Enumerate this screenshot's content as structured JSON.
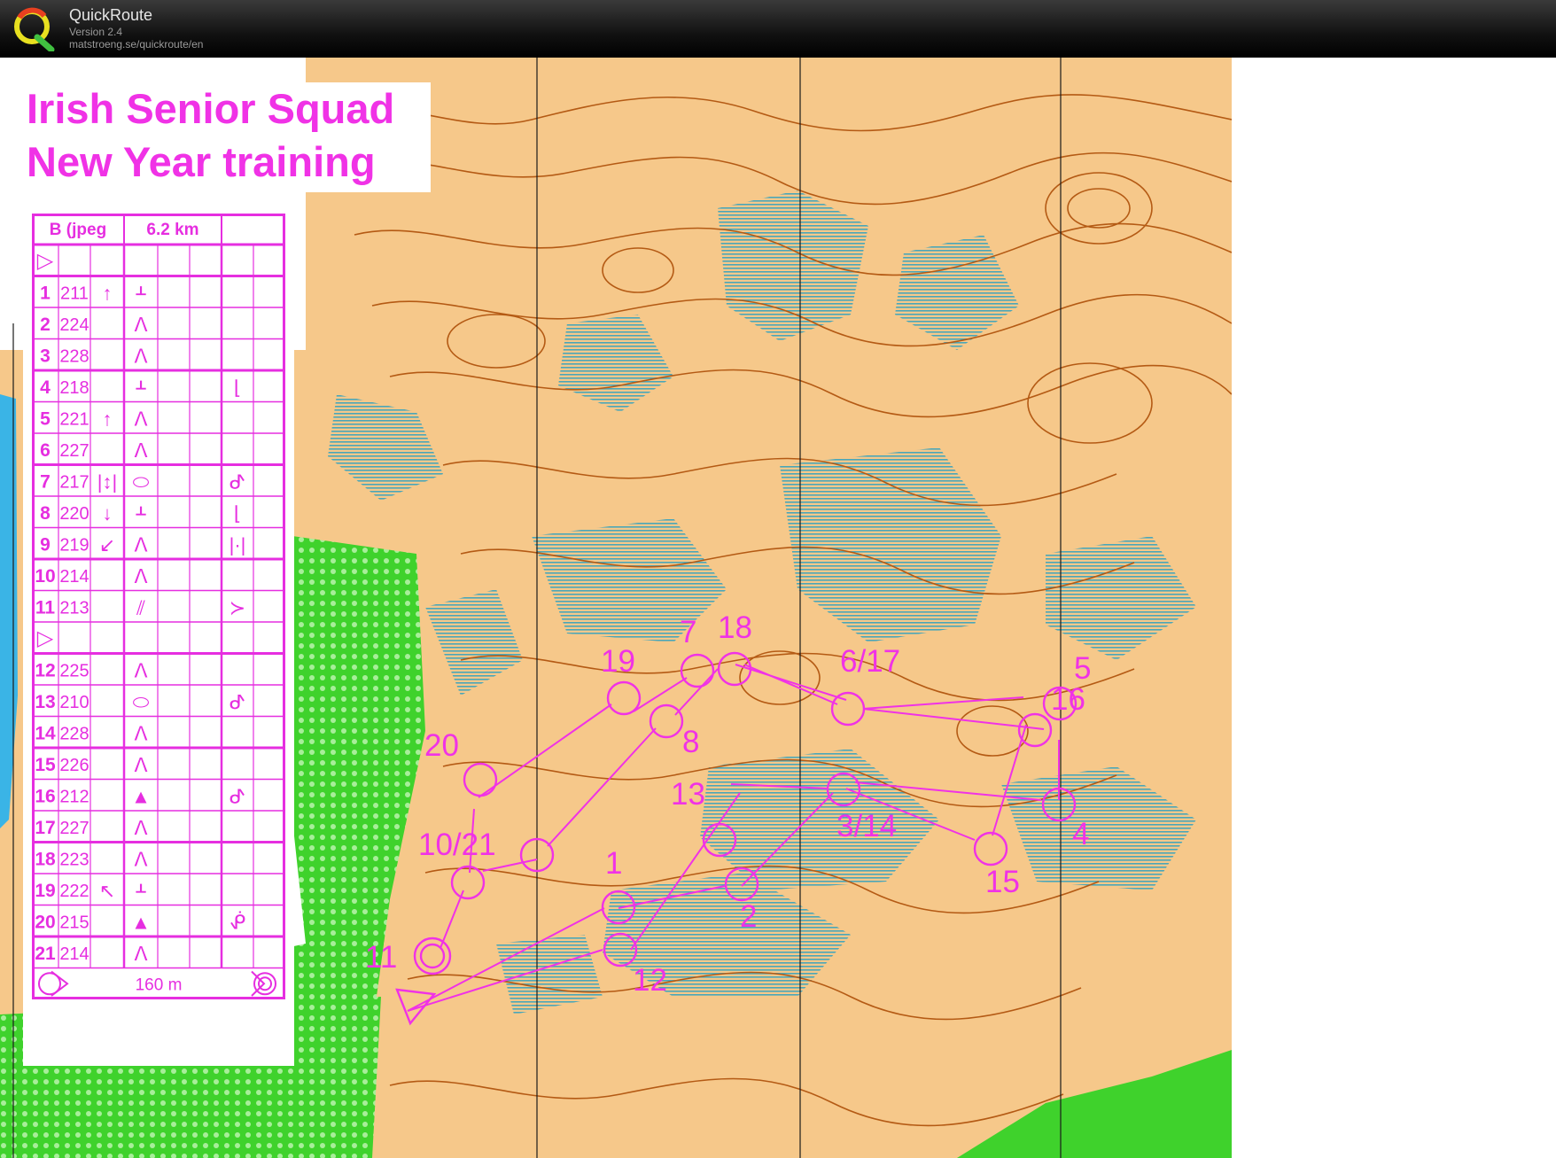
{
  "app": {
    "name": "QuickRoute",
    "version": "Version 2.4",
    "url": "matstroeng.se/quickroute/en"
  },
  "map": {
    "title_line1": "Irish Senior Squad",
    "title_line2": "New Year training",
    "colors": {
      "open_land": "#f6c88a",
      "contour": "#b45a14",
      "marsh": "#4aa6b8",
      "forest": "#3fd22c",
      "course": "#f032e6",
      "water": "#3ab4e6"
    },
    "control_labels": [
      "7",
      "18",
      "19",
      "6/17",
      "5",
      "16",
      "8",
      "20",
      "13",
      "3/14",
      "4",
      "10/21",
      "1",
      "15",
      "2",
      "11",
      "12"
    ]
  },
  "control_card": {
    "course": "B (jpeg",
    "length": "6.2 km",
    "start_symbol": "▷",
    "rows": [
      {
        "num": "1",
        "code": "211",
        "dir": "↑",
        "feat": "ᚆ",
        "extra": ""
      },
      {
        "num": "2",
        "code": "224",
        "dir": "",
        "feat": "ᐱ",
        "extra": ""
      },
      {
        "num": "3",
        "code": "228",
        "dir": "",
        "feat": "ᐱ",
        "extra": ""
      },
      {
        "num": "4",
        "code": "218",
        "dir": "",
        "feat": "ᚆ",
        "extra": "⌊"
      },
      {
        "num": "5",
        "code": "221",
        "dir": "↑",
        "feat": "ᐱ",
        "extra": ""
      },
      {
        "num": "6",
        "code": "227",
        "dir": "",
        "feat": "ᐱ",
        "extra": ""
      },
      {
        "num": "7",
        "code": "217",
        "dir": "|↕|",
        "feat": "⬭",
        "extra": "ᕷ"
      },
      {
        "num": "8",
        "code": "220",
        "dir": "↓",
        "feat": "ᚆ",
        "extra": "⌊"
      },
      {
        "num": "9",
        "code": "219",
        "dir": "↙",
        "feat": "ᐱ",
        "extra": "|·|"
      },
      {
        "num": "10",
        "code": "214",
        "dir": "",
        "feat": "ᐱ",
        "extra": ""
      },
      {
        "num": "11",
        "code": "213",
        "dir": "",
        "feat": "⫽",
        "extra": "≻"
      },
      {
        "num": "",
        "code": "",
        "dir": "",
        "feat": "",
        "extra": "",
        "symbol": "▷"
      },
      {
        "num": "12",
        "code": "225",
        "dir": "",
        "feat": "ᐱ",
        "extra": ""
      },
      {
        "num": "13",
        "code": "210",
        "dir": "",
        "feat": "⬭",
        "extra": "ᕷ"
      },
      {
        "num": "14",
        "code": "228",
        "dir": "",
        "feat": "ᐱ",
        "extra": ""
      },
      {
        "num": "15",
        "code": "226",
        "dir": "",
        "feat": "ᐱ",
        "extra": ""
      },
      {
        "num": "16",
        "code": "212",
        "dir": "",
        "feat": "▲",
        "extra": "ᕷ"
      },
      {
        "num": "17",
        "code": "227",
        "dir": "",
        "feat": "ᐱ",
        "extra": ""
      },
      {
        "num": "18",
        "code": "223",
        "dir": "",
        "feat": "ᐱ",
        "extra": ""
      },
      {
        "num": "19",
        "code": "222",
        "dir": "↖",
        "feat": "ᚆ",
        "extra": ""
      },
      {
        "num": "20",
        "code": "215",
        "dir": "",
        "feat": "▲",
        "extra": "ᕶ"
      },
      {
        "num": "21",
        "code": "214",
        "dir": "",
        "feat": "ᐱ",
        "extra": ""
      }
    ],
    "finish_distance": "160 m"
  }
}
